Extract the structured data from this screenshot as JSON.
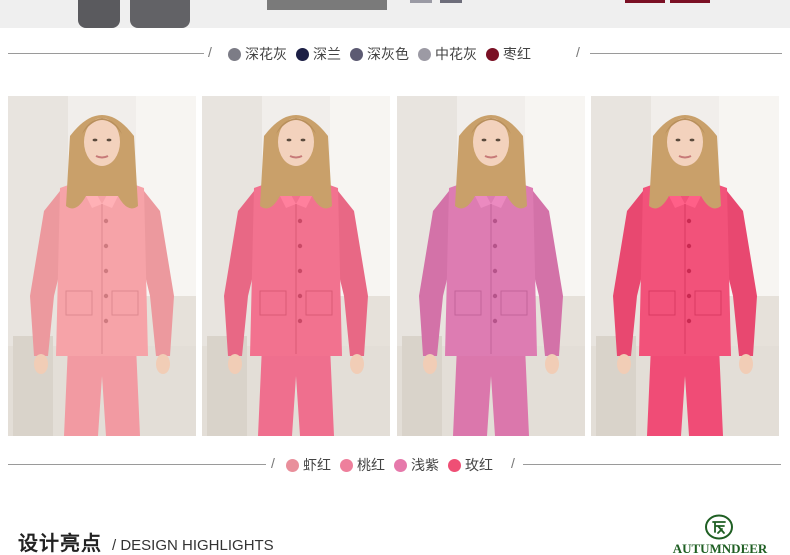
{
  "colors": {
    "deep_heather_grey": "#7c7c86",
    "navy": "#1c1f45",
    "dark_grey": "#5c5a72",
    "mid_heather_grey": "#9c9aa4",
    "jujube_red": "#7a1024",
    "shrimp_red": "#e98f9b",
    "peach_red": "#ee7f9c",
    "light_purple": "#e679ab",
    "rose_red": "#ef4f75"
  },
  "color_row_1": {
    "items": [
      {
        "name": "深花灰",
        "color": "#7c7c86"
      },
      {
        "name": "深兰",
        "color": "#1c1f45"
      },
      {
        "name": "深灰色",
        "color": "#5c5a72"
      },
      {
        "name": "中花灰",
        "color": "#9c9aa4"
      },
      {
        "name": "枣红",
        "color": "#7a1024"
      }
    ]
  },
  "color_row_2": {
    "items": [
      {
        "name": "虾红",
        "color": "#e98f9b"
      },
      {
        "name": "桃红",
        "color": "#ee7f9c"
      },
      {
        "name": "浅紫",
        "color": "#e679ab"
      },
      {
        "name": "玫红",
        "color": "#ef4f75"
      }
    ]
  },
  "photos": [
    {
      "pajama_color": "#f6a3a8",
      "pants_color": "#f29aa2"
    },
    {
      "pajama_color": "#f2728f",
      "pants_color": "#ef6f8e"
    },
    {
      "pajama_color": "#dd7cb2",
      "pants_color": "#db77ac"
    },
    {
      "pajama_color": "#f2527a",
      "pants_color": "#f04c76"
    }
  ],
  "footer": {
    "title_zh": "设计亮点",
    "title_en": "/ DESIGN HIGHLIGHTS"
  },
  "brand": {
    "name": "AUTUMNDEER",
    "logo_icon": "deer-seal-icon"
  }
}
